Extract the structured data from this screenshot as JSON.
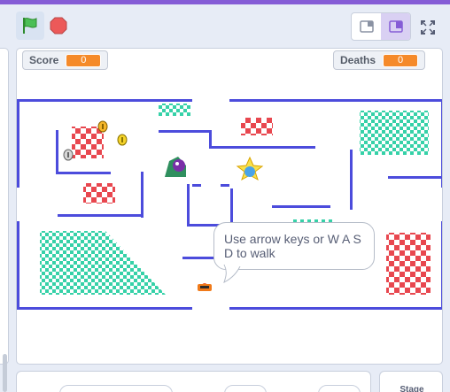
{
  "toolbar": {
    "green_flag_icon": "green-flag-icon",
    "stop_icon": "stop-icon",
    "small_stage_icon": "small-stage-icon",
    "large_stage_icon": "large-stage-icon",
    "fullscreen_icon": "fullscreen-icon"
  },
  "monitors": {
    "score_label": "Score",
    "score_value": "0",
    "deaths_label": "Deaths",
    "deaths_value": "0"
  },
  "speech": {
    "text": "Use arrow keys or W A S D to walk"
  },
  "stage_panel": {
    "label": "Stage"
  },
  "colors": {
    "accent": "#855cd6",
    "wall": "#4c4cdc",
    "monitor_value": "#f58a2a",
    "checker_red": "#e8474f",
    "checker_green": "#36d1a8"
  }
}
